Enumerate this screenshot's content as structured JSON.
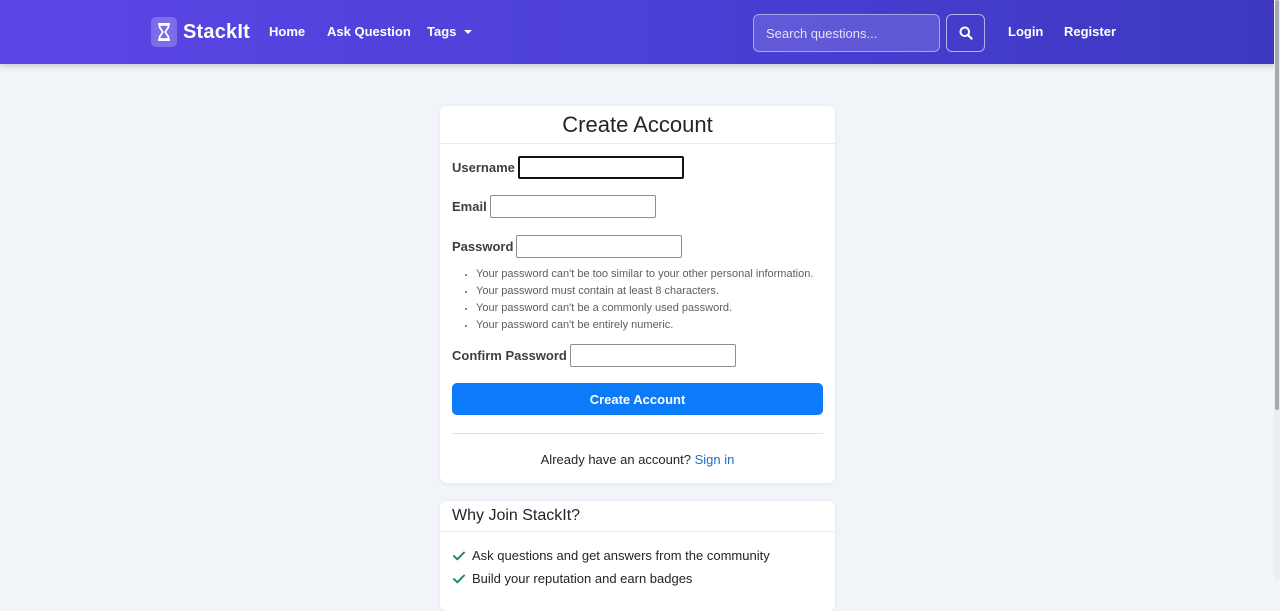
{
  "navbar": {
    "brand": "StackIt",
    "links": {
      "home": "Home",
      "ask": "Ask Question",
      "tags": "Tags",
      "login": "Login",
      "register": "Register"
    },
    "search": {
      "placeholder": "Search questions...",
      "value": ""
    },
    "colors": {
      "gradient_start": "#5b46e6",
      "gradient_end": "#3e38c0",
      "text": "#ffffff"
    }
  },
  "register_card": {
    "title": "Create Account",
    "fields": {
      "username": {
        "label": "Username",
        "value": "",
        "focused": true
      },
      "email": {
        "label": "Email",
        "value": ""
      },
      "password": {
        "label": "Password",
        "value": ""
      },
      "confirm": {
        "label": "Confirm Password",
        "value": ""
      }
    },
    "password_help": [
      "Your password can't be too similar to your other personal information.",
      "Your password must contain at least 8 characters.",
      "Your password can't be a commonly used password.",
      "Your password can't be entirely numeric."
    ],
    "submit_label": "Create Account",
    "signin_prompt": "Already have an account?",
    "signin_link": "Sign in",
    "colors": {
      "primary": "#0b7bfa",
      "link": "#1a6fd0"
    }
  },
  "why_card": {
    "title": "Why Join StackIt?",
    "benefits": [
      "Ask questions and get answers from the community",
      "Build your reputation and earn badges"
    ],
    "icon": "check-icon",
    "check_color": "#198754"
  }
}
